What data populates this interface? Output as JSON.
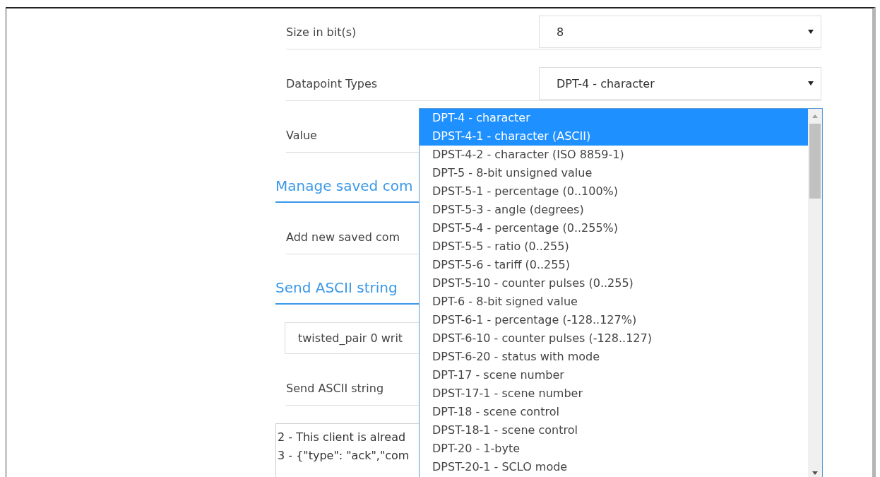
{
  "fields": [
    {
      "label": "Size in bit(s)",
      "value": "8"
    },
    {
      "label": "Datapoint Types",
      "value": "DPT-4 - character"
    }
  ],
  "value_label": "Value",
  "sections": [
    {
      "title": "Manage saved com",
      "items": [
        {
          "kind": "label",
          "text": "Add new saved com"
        }
      ]
    },
    {
      "title": "Send ASCII string",
      "items": [
        {
          "kind": "input",
          "text": "twisted_pair 0 writ"
        },
        {
          "kind": "label",
          "text": "Send ASCII string"
        },
        {
          "kind": "log",
          "lines": [
            "2 - This client is alread",
            "3 - {\"type\": \"ack\",\"com"
          ]
        }
      ]
    }
  ],
  "dropdown": {
    "options": [
      {
        "label": "DPT-4 - character",
        "selected": true
      },
      {
        "label": "DPST-4-1 - character (ASCII)",
        "selected": true
      },
      {
        "label": "DPST-4-2 - character (ISO 8859-1)",
        "selected": false
      },
      {
        "label": "DPT-5 - 8-bit unsigned value",
        "selected": false
      },
      {
        "label": "DPST-5-1 - percentage (0..100%)",
        "selected": false
      },
      {
        "label": "DPST-5-3 - angle (degrees)",
        "selected": false
      },
      {
        "label": "DPST-5-4 - percentage (0..255%)",
        "selected": false
      },
      {
        "label": "DPST-5-5 - ratio (0..255)",
        "selected": false
      },
      {
        "label": "DPST-5-6 - tariff (0..255)",
        "selected": false
      },
      {
        "label": "DPST-5-10 - counter pulses (0..255)",
        "selected": false
      },
      {
        "label": "DPT-6 - 8-bit signed value",
        "selected": false
      },
      {
        "label": "DPST-6-1 - percentage (-128..127%)",
        "selected": false
      },
      {
        "label": "DPST-6-10 - counter pulses (-128..127)",
        "selected": false
      },
      {
        "label": "DPST-6-20 - status with mode",
        "selected": false
      },
      {
        "label": "DPT-17 - scene number",
        "selected": false
      },
      {
        "label": "DPST-17-1 - scene number",
        "selected": false
      },
      {
        "label": "DPT-18 - scene control",
        "selected": false
      },
      {
        "label": "DPST-18-1 - scene control",
        "selected": false
      },
      {
        "label": "DPT-20 - 1-byte",
        "selected": false
      },
      {
        "label": "DPST-20-1 - SCLO mode",
        "selected": false
      }
    ]
  }
}
